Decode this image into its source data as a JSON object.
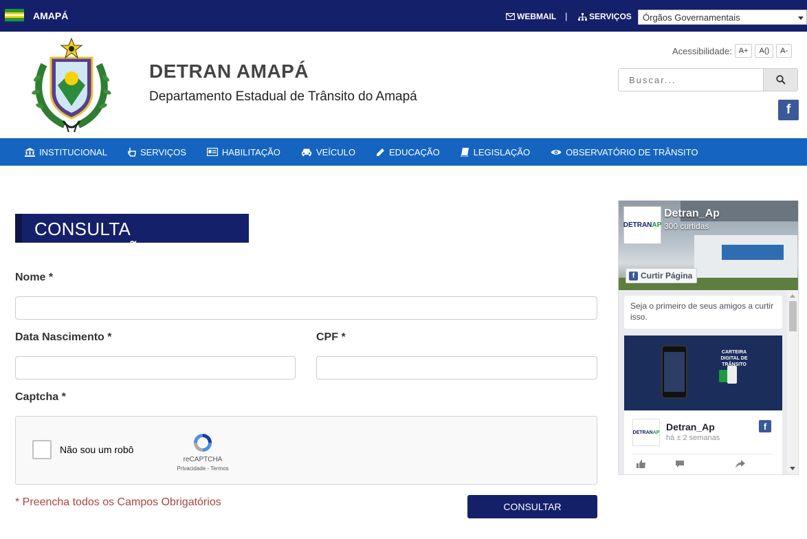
{
  "topbar": {
    "state_name": "AMAPÁ",
    "webmail_label": "WEBMAIL",
    "separator": "|",
    "services_label": "SERVIÇOS",
    "org_select_value": "Órgãos Governamentais"
  },
  "header": {
    "title": "DETRAN AMAPÁ",
    "subtitle": "Departamento Estadual de Trânsito do Amapá",
    "accessibility_label": "Acessibilidade:",
    "font_increase": "A+",
    "font_reset": "A()",
    "font_decrease": "A-",
    "search_placeholder": "Buscar...",
    "facebook_glyph": "f"
  },
  "nav": {
    "items": [
      {
        "label": "INSTITUCIONAL",
        "icon": "bank-icon"
      },
      {
        "label": "SERVIÇOS",
        "icon": "hand-pointer-icon"
      },
      {
        "label": "HABILITAÇÃO",
        "icon": "id-card-icon"
      },
      {
        "label": "VEÍCULO",
        "icon": "car-icon"
      },
      {
        "label": "EDUCAÇÃO",
        "icon": "pencil-icon"
      },
      {
        "label": "LEGISLAÇÃO",
        "icon": "book-icon"
      },
      {
        "label": "OBSERVATÓRIO DE TRÂNSITO",
        "icon": "eye-icon"
      }
    ]
  },
  "form": {
    "page_title": "CONSULTA HABILITAÇÃO",
    "name_label": "Nome *",
    "birth_label": "Data Nascimento *",
    "cpf_label": "CPF *",
    "captcha_label": "Captcha *",
    "captcha_checkbox_label": "Não sou um robô",
    "captcha_brand": "reCAPTCHA",
    "captcha_terms": "Privacidade - Termos",
    "required_note": "* Preencha todos os Campos Obrigatórios",
    "submit_label": "CONSULTAR"
  },
  "facebook_widget": {
    "page_name": "Detran_Ap",
    "likes": "300 curtidas",
    "like_button": "Curtir Página",
    "friends_text": "Seja o primeiro de seus amigos a curtir isso.",
    "avatar_text_a": "DETRAN",
    "avatar_text_b": "AP",
    "post_image_caption": "CARTEIRA DIGITAL DE TRÂNSITO",
    "post_author": "Detran_Ap",
    "post_time": "há ± 2 semanas"
  },
  "colors": {
    "topbar": "#15206b",
    "nav": "#1565c0",
    "facebook": "#3b5998",
    "required": "#a94442"
  }
}
